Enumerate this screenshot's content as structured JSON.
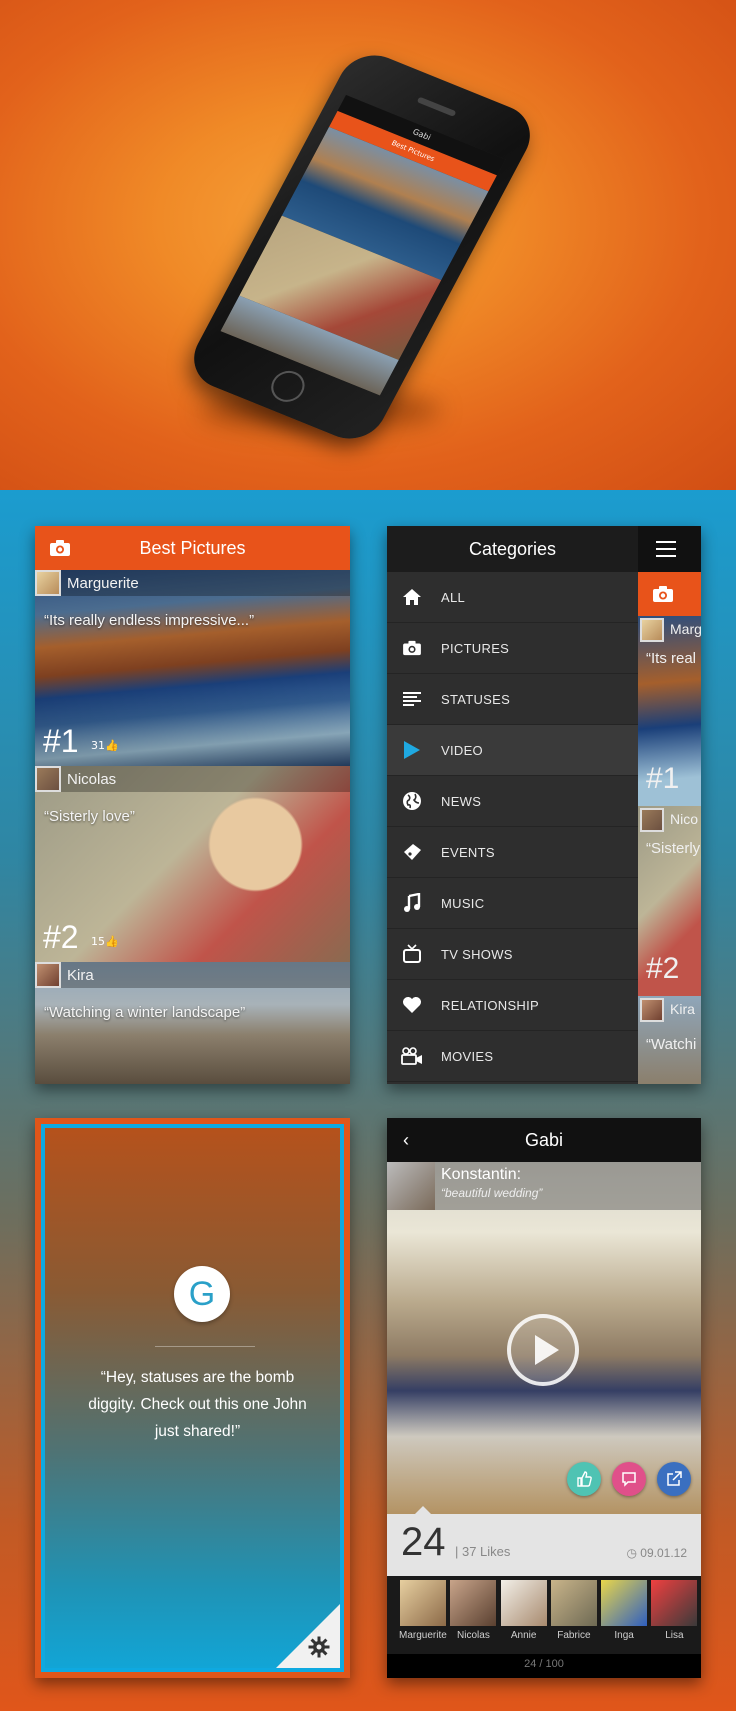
{
  "hero": {
    "phone_top_title": "Gabi",
    "phone_section": "Best Pictures"
  },
  "best": {
    "title": "Best Pictures",
    "cards": [
      {
        "author": "Marguerite",
        "quote": "“Its really endless impressive...”",
        "rank": "#1",
        "likes": "31"
      },
      {
        "author": "Nicolas",
        "quote": "“Sisterly love”",
        "rank": "#2",
        "likes": "15"
      },
      {
        "author": "Kira",
        "quote": "“Watching a winter landscape”"
      }
    ]
  },
  "categories": {
    "title": "Categories",
    "items": [
      {
        "label": "ALL",
        "icon": "home-icon"
      },
      {
        "label": "PICTURES",
        "icon": "camera-icon"
      },
      {
        "label": "STATUSES",
        "icon": "lines-icon"
      },
      {
        "label": "VIDEO",
        "icon": "play-icon",
        "active": true
      },
      {
        "label": "NEWS",
        "icon": "globe-icon"
      },
      {
        "label": "EVENTS",
        "icon": "ticket-icon"
      },
      {
        "label": "MUSIC",
        "icon": "music-note-icon"
      },
      {
        "label": "TV SHOWS",
        "icon": "tv-icon"
      },
      {
        "label": "RELATIONSHIP",
        "icon": "heart-icon"
      },
      {
        "label": "MOVIES",
        "icon": "movie-camera-icon"
      }
    ],
    "peek": {
      "author1": "Marg",
      "quote1": "“Its real",
      "rank1": "#1",
      "author2": "Nico",
      "quote2": "“Sisterly",
      "rank2": "#2",
      "author3": "Kira",
      "quote3": "“Watchi"
    }
  },
  "status": {
    "logo_letter": "G",
    "quote": "“Hey, statuses are the bomb diggity. Check out this one John just shared!”"
  },
  "gabi": {
    "title": "Gabi",
    "author": "Konstantin:",
    "caption": "“beautiful wedding”",
    "likes_count": "24",
    "likes_label": "| 37 Likes",
    "date": "◷ 09.01.12",
    "friends": [
      "Marguerite",
      "Nicolas",
      "Annie",
      "Fabrice",
      "Inga",
      "Lisa"
    ],
    "pager": "24 / 100",
    "colors": {
      "like": "#4fc3b3",
      "comment": "#e0508a",
      "share": "#3a6fc0"
    }
  },
  "accent": "#e8531a"
}
